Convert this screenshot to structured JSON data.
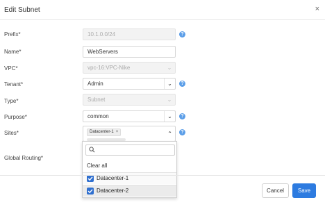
{
  "dialog": {
    "title": "Edit Subnet",
    "close": "×"
  },
  "fields": {
    "prefix": {
      "label": "Prefix*",
      "value": "10.1.0.0/24"
    },
    "name": {
      "label": "Name*",
      "value": "WebServers"
    },
    "vpc": {
      "label": "VPC*",
      "value": "vpc-16:VPC-Nike"
    },
    "tenant": {
      "label": "Tenant*",
      "value": "Admin"
    },
    "type": {
      "label": "Type*",
      "value": "Subnet"
    },
    "purpose": {
      "label": "Purpose*",
      "value": "common"
    },
    "sites": {
      "label": "Sites*",
      "chip": "Datacenter-1",
      "chip_remove": "×"
    },
    "global_routing": {
      "label": "Global Routing*"
    }
  },
  "help_glyph": "?",
  "dropdown": {
    "search_placeholder": "",
    "clear_all": "Clear all",
    "options": [
      {
        "label": "Datacenter-1",
        "checked": true
      },
      {
        "label": "Datacenter-2",
        "checked": true
      }
    ]
  },
  "footer": {
    "cancel": "Cancel",
    "save": "Save"
  },
  "colors": {
    "primary": "#2d7be0",
    "help": "#5b9ee8",
    "checkbox": "#2f6fcf"
  }
}
